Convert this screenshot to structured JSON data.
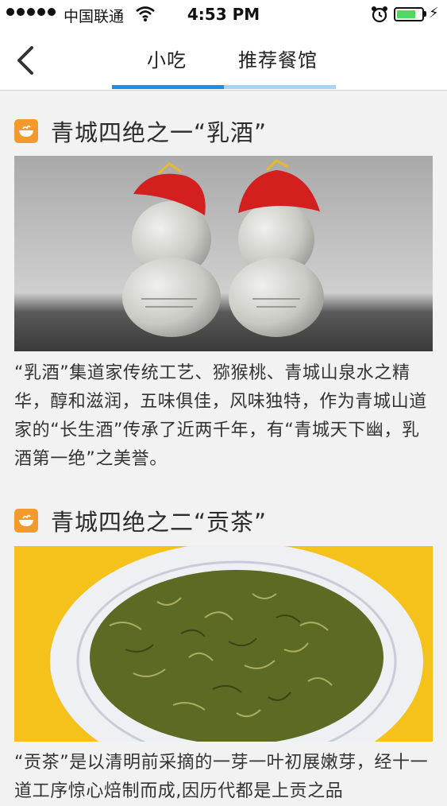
{
  "status_bar": {
    "carrier": "中国联通",
    "time": "4:53 PM",
    "battery_level": 0.75,
    "signal_icon": "signal-dots-icon",
    "wifi_icon": "wifi-icon",
    "alarm_icon": "alarm-clock-icon",
    "charging_icon": "lightning-bolt-icon"
  },
  "nav": {
    "back_icon": "chevron-left-icon",
    "tabs": [
      {
        "label": "小吃",
        "active": true
      },
      {
        "label": "推荐餐馆",
        "active": false
      }
    ],
    "accent_color": "#1d8ee8"
  },
  "sections": [
    {
      "icon": "food-bowl-icon",
      "title": "青城四绝之一“乳酒”",
      "image": "two gourd-shaped white ceramic liquor bottles with red cloth caps",
      "description": "“乳酒”集道家传统工艺、猕猴桃、青城山泉水之精华，醇和滋润，五味俱佳，风味独特，作为青城山道家的“长生酒”传承了近两千年，有“青城天下幽，乳酒第一绝”之美誉。"
    },
    {
      "icon": "food-bowl-icon",
      "title": "青城四绝之二“贡茶”",
      "image": "white plate of curly green tea leaves on yellow background",
      "description": "“贡茶”是以清明前采摘的一芽一叶初展嫩芽，经十一道工序惊心焙制而成,因历代都是上贡之品"
    }
  ]
}
